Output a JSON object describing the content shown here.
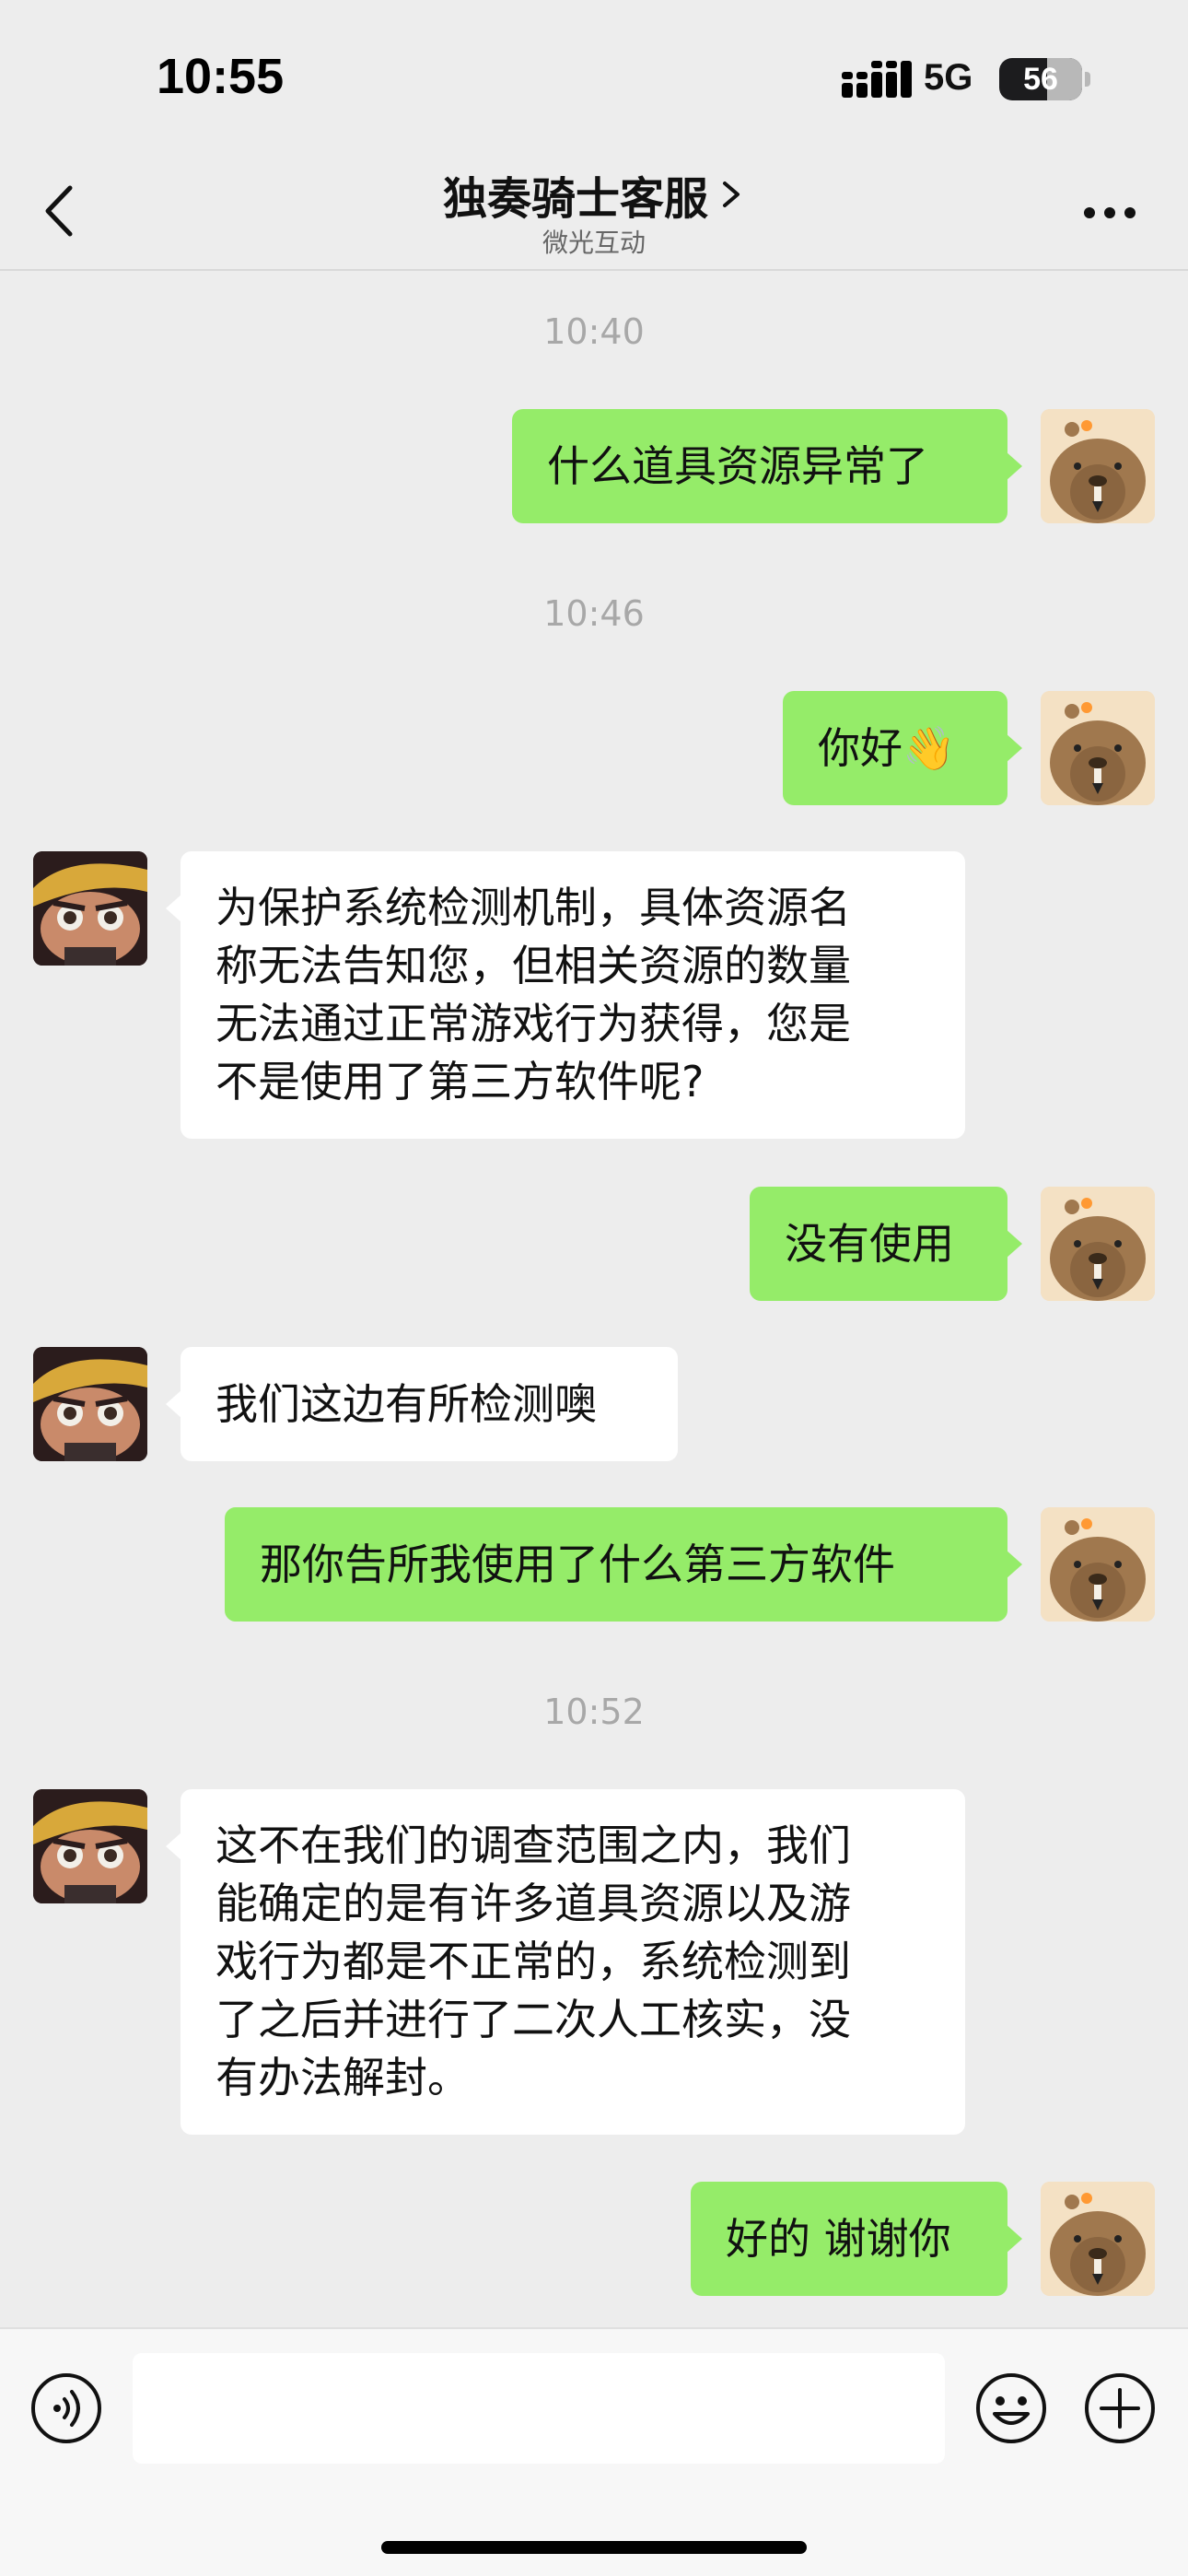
{
  "status_bar": {
    "time": "10:55",
    "network": "5G",
    "battery": "56"
  },
  "nav": {
    "title": "独奏骑士客服",
    "subtitle": "微光互动"
  },
  "messages": [
    {
      "type": "timestamp",
      "text": "10:40"
    },
    {
      "type": "me",
      "lines": [
        "什么道具资源异常了"
      ]
    },
    {
      "type": "timestamp",
      "text": "10:46"
    },
    {
      "type": "me",
      "lines": [
        "你好👋"
      ]
    },
    {
      "type": "agent",
      "lines": [
        "为保护系统检测机制，具体资源名",
        "称无法告知您，但相关资源的数量",
        "无法通过正常游戏行为获得，您是",
        "不是使用了第三方软件呢?"
      ]
    },
    {
      "type": "me",
      "lines": [
        "没有使用"
      ]
    },
    {
      "type": "agent",
      "lines": [
        "我们这边有所检测噢"
      ]
    },
    {
      "type": "me",
      "lines": [
        "那你告所我使用了什么第三方软件"
      ]
    },
    {
      "type": "timestamp",
      "text": "10:52"
    },
    {
      "type": "agent",
      "lines": [
        "这不在我们的调查范围之内，我们",
        "能确定的是有许多道具资源以及游",
        "戏行为都是不正常的，系统检测到",
        "了之后并进行了二次人工核实，没",
        "有办法解封。"
      ]
    },
    {
      "type": "me",
      "lines": [
        "好的 谢谢你"
      ]
    }
  ],
  "icons": {
    "back": "chevron-left-icon",
    "title_chevron": "chevron-right-icon",
    "more": "more-dots-icon",
    "voice": "voice-icon",
    "emoji": "emoji-icon",
    "plus": "plus-icon"
  },
  "colors": {
    "my_bubble": "#95ec69",
    "agent_bubble": "#ffffff",
    "background": "#ededed"
  }
}
